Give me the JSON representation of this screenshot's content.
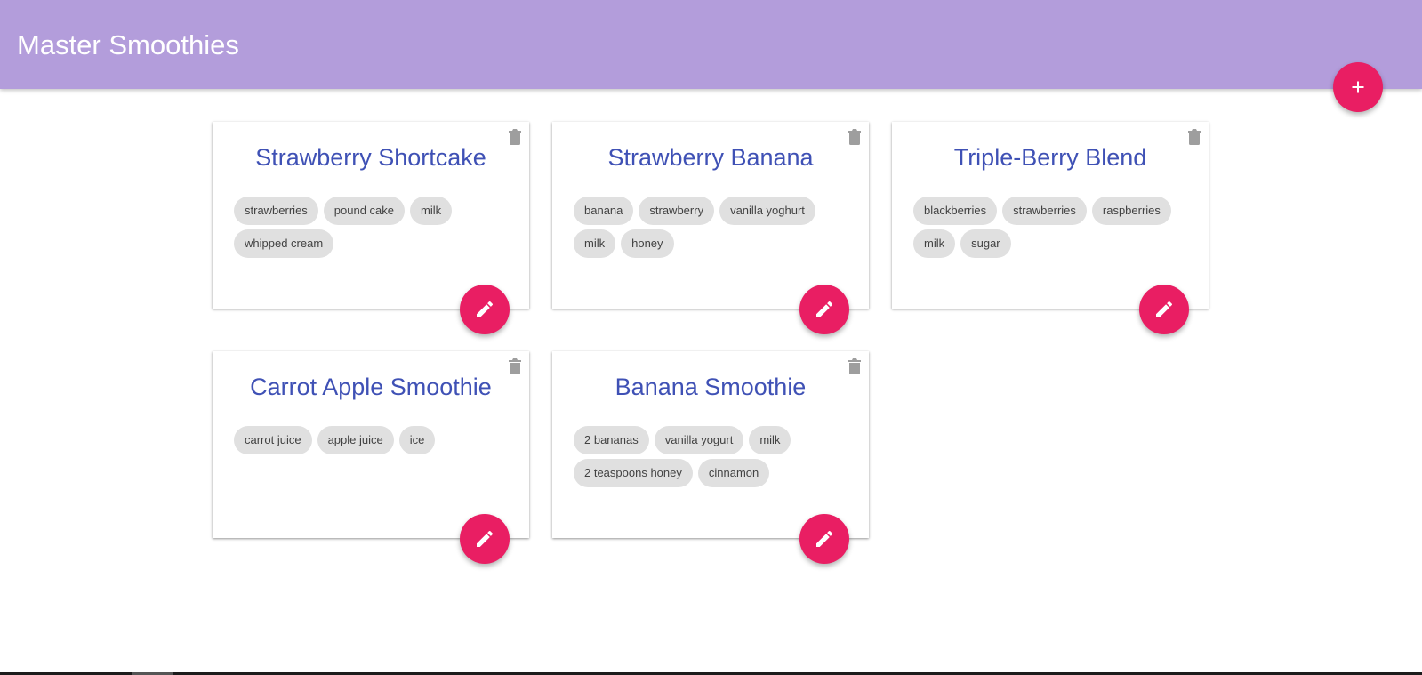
{
  "header": {
    "title": "Master Smoothies",
    "add_button_icon": "plus-icon"
  },
  "colors": {
    "app_bar": "#b39ddb",
    "accent": "#e91e63",
    "card_title": "#3f51b5",
    "chip_background": "#e0e0e0",
    "delete_icon": "#9e9e9e"
  },
  "cards": [
    {
      "title": "Strawberry Shortcake",
      "ingredients": [
        "strawberries",
        "pound cake",
        "milk",
        "whipped cream"
      ],
      "delete_icon": "trash-icon",
      "edit_icon": "pencil-icon"
    },
    {
      "title": "Strawberry Banana",
      "ingredients": [
        "banana",
        "strawberry",
        "vanilla yoghurt",
        "milk",
        "honey"
      ],
      "delete_icon": "trash-icon",
      "edit_icon": "pencil-icon"
    },
    {
      "title": "Triple-Berry Blend",
      "ingredients": [
        "blackberries",
        "strawberries",
        "raspberries",
        "milk",
        "sugar"
      ],
      "delete_icon": "trash-icon",
      "edit_icon": "pencil-icon"
    },
    {
      "title": "Carrot Apple Smoothie",
      "ingredients": [
        "carrot juice",
        "apple juice",
        "ice"
      ],
      "delete_icon": "trash-icon",
      "edit_icon": "pencil-icon"
    },
    {
      "title": "Banana Smoothie",
      "ingredients": [
        "2 bananas",
        "vanilla yogurt",
        "milk",
        "2 teaspoons honey",
        "cinnamon"
      ],
      "delete_icon": "trash-icon",
      "edit_icon": "pencil-icon"
    }
  ]
}
